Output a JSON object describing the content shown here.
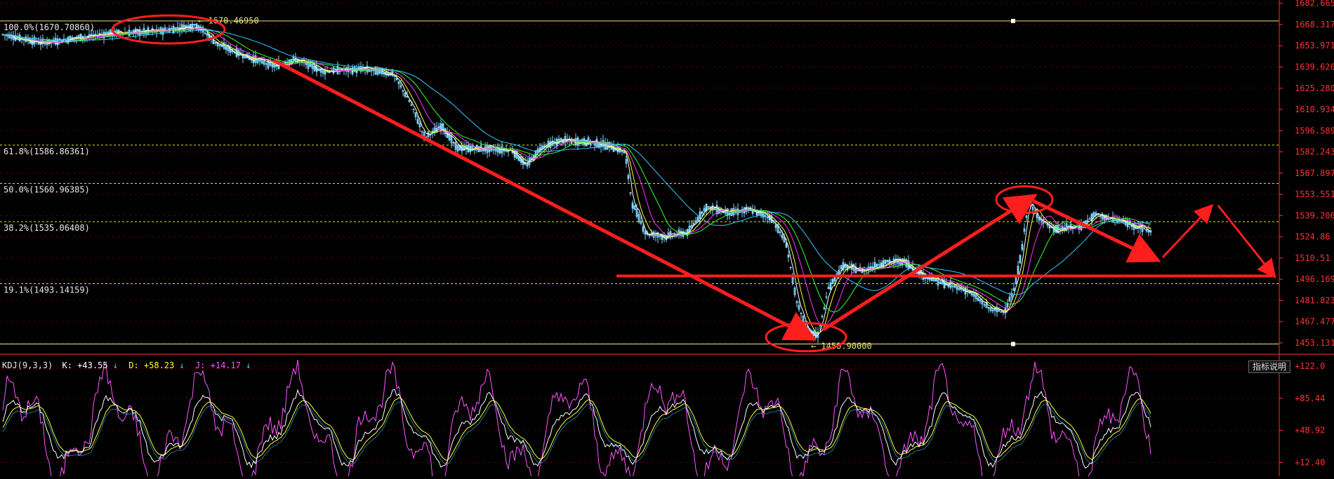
{
  "colors": {
    "background": "#000000",
    "axis": "#ff3030",
    "grid": "#5a0000",
    "fib_solid": "#e6e67a",
    "fib_dashed": "#e6e630",
    "annotation": "#ff1e1e",
    "candle": "#7fd8ff",
    "ma5": "#ffffff",
    "ma10": "#ffff33",
    "ma20": "#ff33ff",
    "ma30": "#33ff33",
    "ma60": "#33ccff",
    "kdj_k": "#ffffff",
    "kdj_d": "#ffff33",
    "kdj_j": "#ff55ff"
  },
  "chart_data": [
    {
      "type": "candlestick",
      "title": "",
      "ylim": [
        1446.0,
        1683.0
      ],
      "y_ticks": [
        "1682.665",
        "1668.317",
        "1653.971",
        "1639.626",
        "1625.280",
        "1610.934",
        "1596.589",
        "1582.243",
        "1567.897",
        "1553.551",
        "1539.206",
        "1524.86",
        "1510.51",
        "1496.169",
        "1481.823",
        "1467.477",
        "1453.131"
      ],
      "y_tick_values": [
        1682.665,
        1668.317,
        1653.971,
        1639.626,
        1625.28,
        1610.934,
        1596.589,
        1582.243,
        1567.897,
        1553.551,
        1539.206,
        1524.86,
        1510.51,
        1496.169,
        1481.823,
        1467.477,
        1453.131
      ],
      "fib_levels": [
        {
          "label": "100.0%(1670.70860)",
          "value": 1670.7086,
          "style": "solid"
        },
        {
          "label": "61.8%(1586.86361)",
          "value": 1586.86361,
          "style": "dashed"
        },
        {
          "label": "50.0%(1560.96385)",
          "value": 1560.96385,
          "style": "dashed"
        },
        {
          "label": "38.2%(1535.06408)",
          "value": 1535.06408,
          "style": "dashed"
        },
        {
          "label": "19.1%(1493.14159)",
          "value": 1493.14159,
          "style": "dashed"
        },
        {
          "label": "",
          "value": 1452.4,
          "style": "solid"
        }
      ],
      "extremes": [
        {
          "label": "1670.46950",
          "value": 1670.4695
        },
        {
          "label": "1450.90000",
          "value": 1450.9
        }
      ],
      "price_path": [
        [
          0,
          1662
        ],
        [
          60,
          1656
        ],
        [
          150,
          1662
        ],
        [
          230,
          1664
        ],
        [
          280,
          1668
        ],
        [
          310,
          1655
        ],
        [
          340,
          1649
        ],
        [
          390,
          1640
        ],
        [
          420,
          1645
        ],
        [
          460,
          1637
        ],
        [
          520,
          1638
        ],
        [
          560,
          1635
        ],
        [
          585,
          1615
        ],
        [
          605,
          1592
        ],
        [
          630,
          1600
        ],
        [
          650,
          1585
        ],
        [
          700,
          1584
        ],
        [
          730,
          1583
        ],
        [
          750,
          1573
        ],
        [
          770,
          1585
        ],
        [
          800,
          1590
        ],
        [
          840,
          1589
        ],
        [
          870,
          1586
        ],
        [
          890,
          1582
        ],
        [
          900,
          1548
        ],
        [
          920,
          1527
        ],
        [
          950,
          1525
        ],
        [
          980,
          1528
        ],
        [
          1005,
          1545
        ],
        [
          1040,
          1541
        ],
        [
          1070,
          1543
        ],
        [
          1100,
          1537
        ],
        [
          1120,
          1520
        ],
        [
          1135,
          1480
        ],
        [
          1150,
          1462
        ],
        [
          1165,
          1458
        ],
        [
          1180,
          1490
        ],
        [
          1200,
          1505
        ],
        [
          1230,
          1502
        ],
        [
          1260,
          1508
        ],
        [
          1290,
          1508
        ],
        [
          1310,
          1500
        ],
        [
          1340,
          1494
        ],
        [
          1380,
          1488
        ],
        [
          1410,
          1476
        ],
        [
          1430,
          1474
        ],
        [
          1445,
          1490
        ],
        [
          1455,
          1515
        ],
        [
          1465,
          1549
        ],
        [
          1475,
          1540
        ],
        [
          1500,
          1530
        ],
        [
          1540,
          1532
        ],
        [
          1560,
          1540
        ],
        [
          1590,
          1536
        ],
        [
          1620,
          1532
        ],
        [
          1640,
          1528
        ]
      ]
    },
    {
      "type": "line",
      "title": "KDJ(9,3,3)",
      "series": [
        {
          "name": "K",
          "last": "+43.55"
        },
        {
          "name": "D",
          "last": "+58.23"
        },
        {
          "name": "J",
          "last": "+14.17"
        }
      ],
      "ylim": [
        0,
        130
      ],
      "y_ticks": [
        "+122.0",
        "+85.44",
        "+48.92",
        "+12.40"
      ],
      "y_tick_values": [
        122.0,
        85.44,
        48.92,
        12.4
      ]
    }
  ],
  "labels": {
    "kdj_prefix": "KDJ(9,3,3)",
    "k_text": "K: +43.55",
    "d_text": "D: +58.23",
    "j_text": "J: +14.17",
    "indicator_button": "指标说明"
  }
}
